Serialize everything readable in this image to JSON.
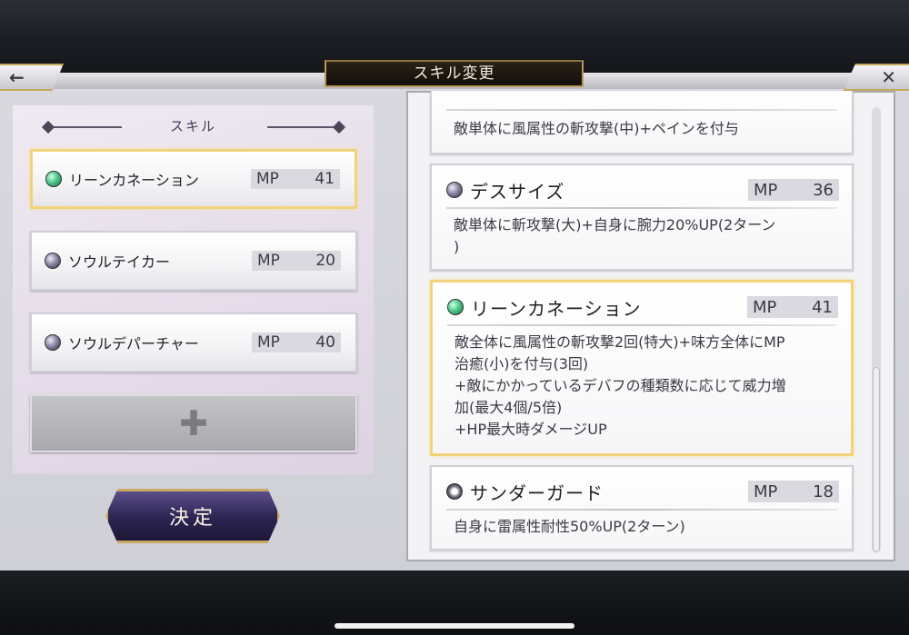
{
  "header": {
    "title": "スキル変更",
    "back_icon": "←",
    "close_icon": "✕"
  },
  "equipped": {
    "heading": "スキル",
    "slots": [
      {
        "name": "リーンカネーション",
        "mp_label": "MP",
        "mp": "41",
        "icon": "green-orb-icon",
        "selected": true
      },
      {
        "name": "ソウルテイカー",
        "mp_label": "MP",
        "mp": "20",
        "icon": "purple-orb-icon",
        "selected": false
      },
      {
        "name": "ソウルデパーチャー",
        "mp_label": "MP",
        "mp": "40",
        "icon": "purple-orb-icon",
        "selected": false
      }
    ],
    "add_symbol": "✚"
  },
  "confirm_label": "決定",
  "skill_list": [
    {
      "name": "",
      "desc": "敵単体に風属性の斬攻撃(中)+ペインを付与"
    },
    {
      "name": "デスサイズ",
      "mp_label": "MP",
      "mp": "36",
      "icon": "purple-orb-icon",
      "desc": "敵単体に斬攻撃(大)+自身に腕力20%UP(2ターン\n)"
    },
    {
      "name": "リーンカネーション",
      "mp_label": "MP",
      "mp": "41",
      "icon": "green-orb-icon",
      "selected": true,
      "desc": "敵全体に風属性の斬攻撃2回(特大)+味方全体にMP\n治癒(小)を付与(3回)\n+敵にかかっているデバフの種類数に応じて威力増\n加(最大4個/5倍)\n+HP最大時ダメージUP"
    },
    {
      "name": "サンダーガード",
      "mp_label": "MP",
      "mp": "18",
      "icon": "lightning-orb-icon",
      "desc": "自身に雷属性耐性50%UP(2ターン)"
    }
  ],
  "colors": {
    "accent_gold": "#f1d37c",
    "confirm_purple": "#2c2452",
    "panel_bg": "#f3f3f6"
  }
}
